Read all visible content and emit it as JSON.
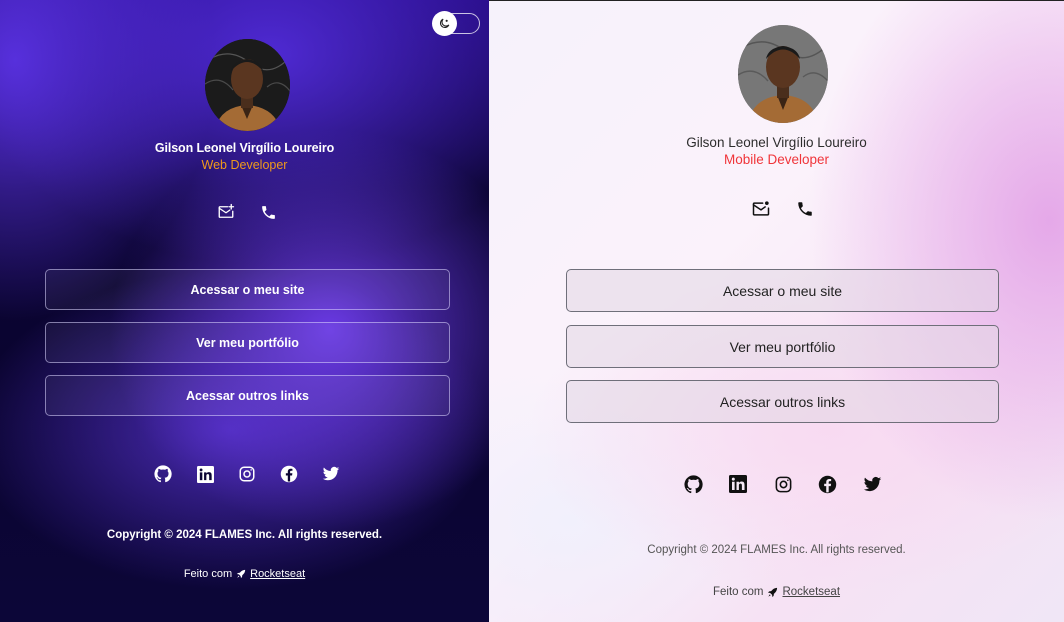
{
  "profile": {
    "name": "Gilson Leonel Virgílio Loureiro"
  },
  "dark_card": {
    "role": "Web Developer",
    "buttons": [
      "Acessar o meu site",
      "Ver meu portfólio",
      "Acessar outros links"
    ],
    "copyright": "Copyright © 2024 FLAMES Inc. All rights reserved.",
    "made_with": "Feito com",
    "made_with_link": "Rocketseat"
  },
  "light_card": {
    "role": "Mobile Developer",
    "buttons": [
      "Acessar o meu site",
      "Ver meu portfólio",
      "Acessar outros links"
    ],
    "copyright": "Copyright © 2024 FLAMES Inc. All rights reserved.",
    "made_with": "Feito com",
    "made_with_link": "Rocketseat"
  },
  "icons": {
    "theme_toggle": "moon-sun-icon",
    "contacts": [
      "mail-icon",
      "phone-icon"
    ],
    "socials": [
      "github-icon",
      "linkedin-icon",
      "instagram-icon",
      "facebook-icon",
      "twitter-icon"
    ],
    "made_with": "rocket-icon"
  },
  "colors": {
    "dark_role": "#f09a1c",
    "light_role": "#f0353a",
    "dark_bg": "#0c0534",
    "accent_purple": "#5a30e6",
    "light_accent_pink": "#e4a5e8"
  }
}
